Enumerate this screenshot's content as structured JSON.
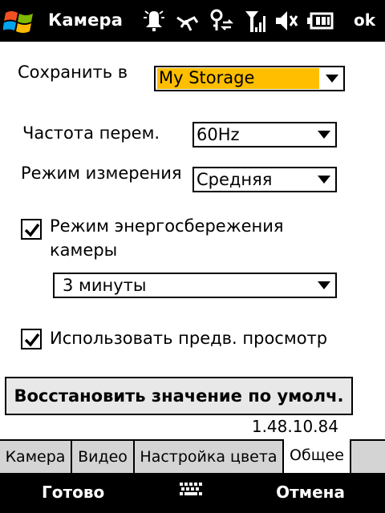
{
  "titlebar": {
    "app_title": "Камера",
    "ok_label": "ok",
    "icons": [
      "windows-logo-icon",
      "notification-icon",
      "connectivity-icon",
      "sync-icon",
      "signal-icon",
      "volume-icon",
      "battery-icon"
    ]
  },
  "form": {
    "save_to": {
      "label": "Сохранить в",
      "value": "My Storage"
    },
    "flicker": {
      "label": "Частота перем.",
      "value": "60Hz"
    },
    "metering": {
      "label": "Режим измерения",
      "value": "Средняя"
    },
    "power_save": {
      "label_line1": "Режим энергосбережения",
      "label_line2": "камеры",
      "checked": true,
      "value": "3 минуты"
    },
    "preview": {
      "label": "Использовать предв. просмотр",
      "checked": true
    }
  },
  "reset_button": "Восстановить значение по умолч.",
  "version": "1.48.10.84",
  "tabs": [
    {
      "label": "Камера",
      "active": false
    },
    {
      "label": "Видео",
      "active": false
    },
    {
      "label": "Настройка цвета",
      "active": false
    },
    {
      "label": "Общее",
      "active": true
    }
  ],
  "softkeys": {
    "left": "Готово",
    "right": "Отмена"
  },
  "colors": {
    "highlight": "#ffbe00",
    "bar": "#000000",
    "tab_bg": "#d4d4d4"
  }
}
